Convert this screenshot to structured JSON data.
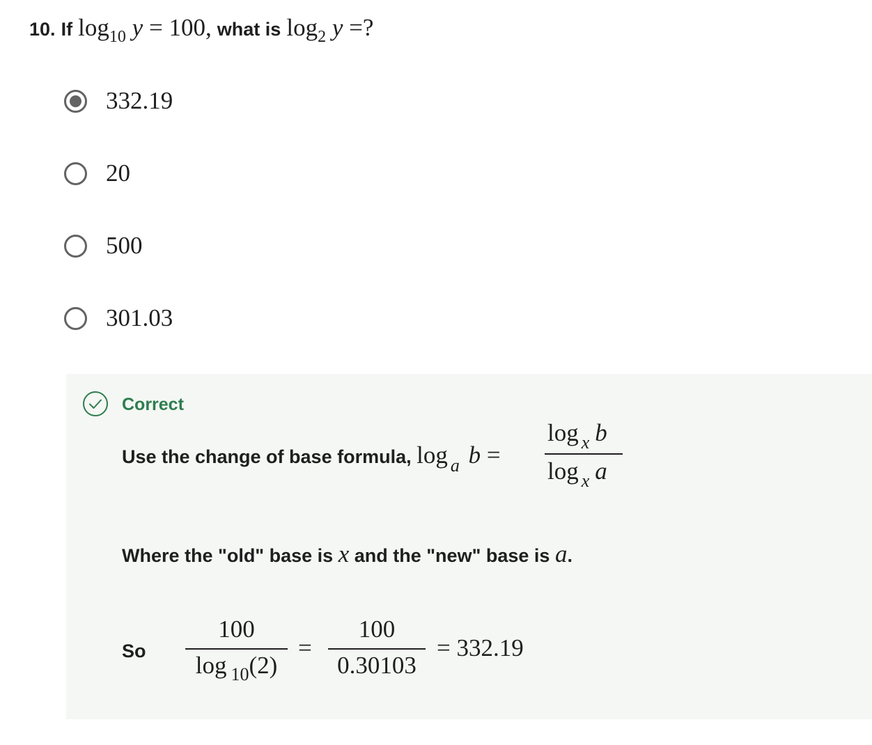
{
  "question": {
    "number": "10.",
    "if_word": "If",
    "log_word": "log",
    "base1": "10",
    "var": "y",
    "equals_100": "= 100,",
    "what_is": "what is",
    "base2": "2",
    "equals_q": "=?"
  },
  "options": [
    {
      "label": "332.19",
      "selected": true
    },
    {
      "label": "20",
      "selected": false
    },
    {
      "label": "500",
      "selected": false
    },
    {
      "label": "301.03",
      "selected": false
    }
  ],
  "feedback": {
    "status": "Correct",
    "status_color": "#2e7d4f",
    "icon": "check-circle-icon",
    "formula_intro": "Use the change of base formula,",
    "log_word": "log",
    "a": "a",
    "b": "b",
    "x": "x",
    "eq": "=",
    "where_part1": "Where the \"old\" base is",
    "where_part2": "and the \"new\" base is",
    "where_end": ".",
    "so_label": "So",
    "frac2_num": "100",
    "frac2_den_log": "log",
    "frac2_den_base": "10",
    "frac2_den_arg": "(2)",
    "frac3_num": "100",
    "frac3_den": "0.30103",
    "result": "= 332.19"
  }
}
